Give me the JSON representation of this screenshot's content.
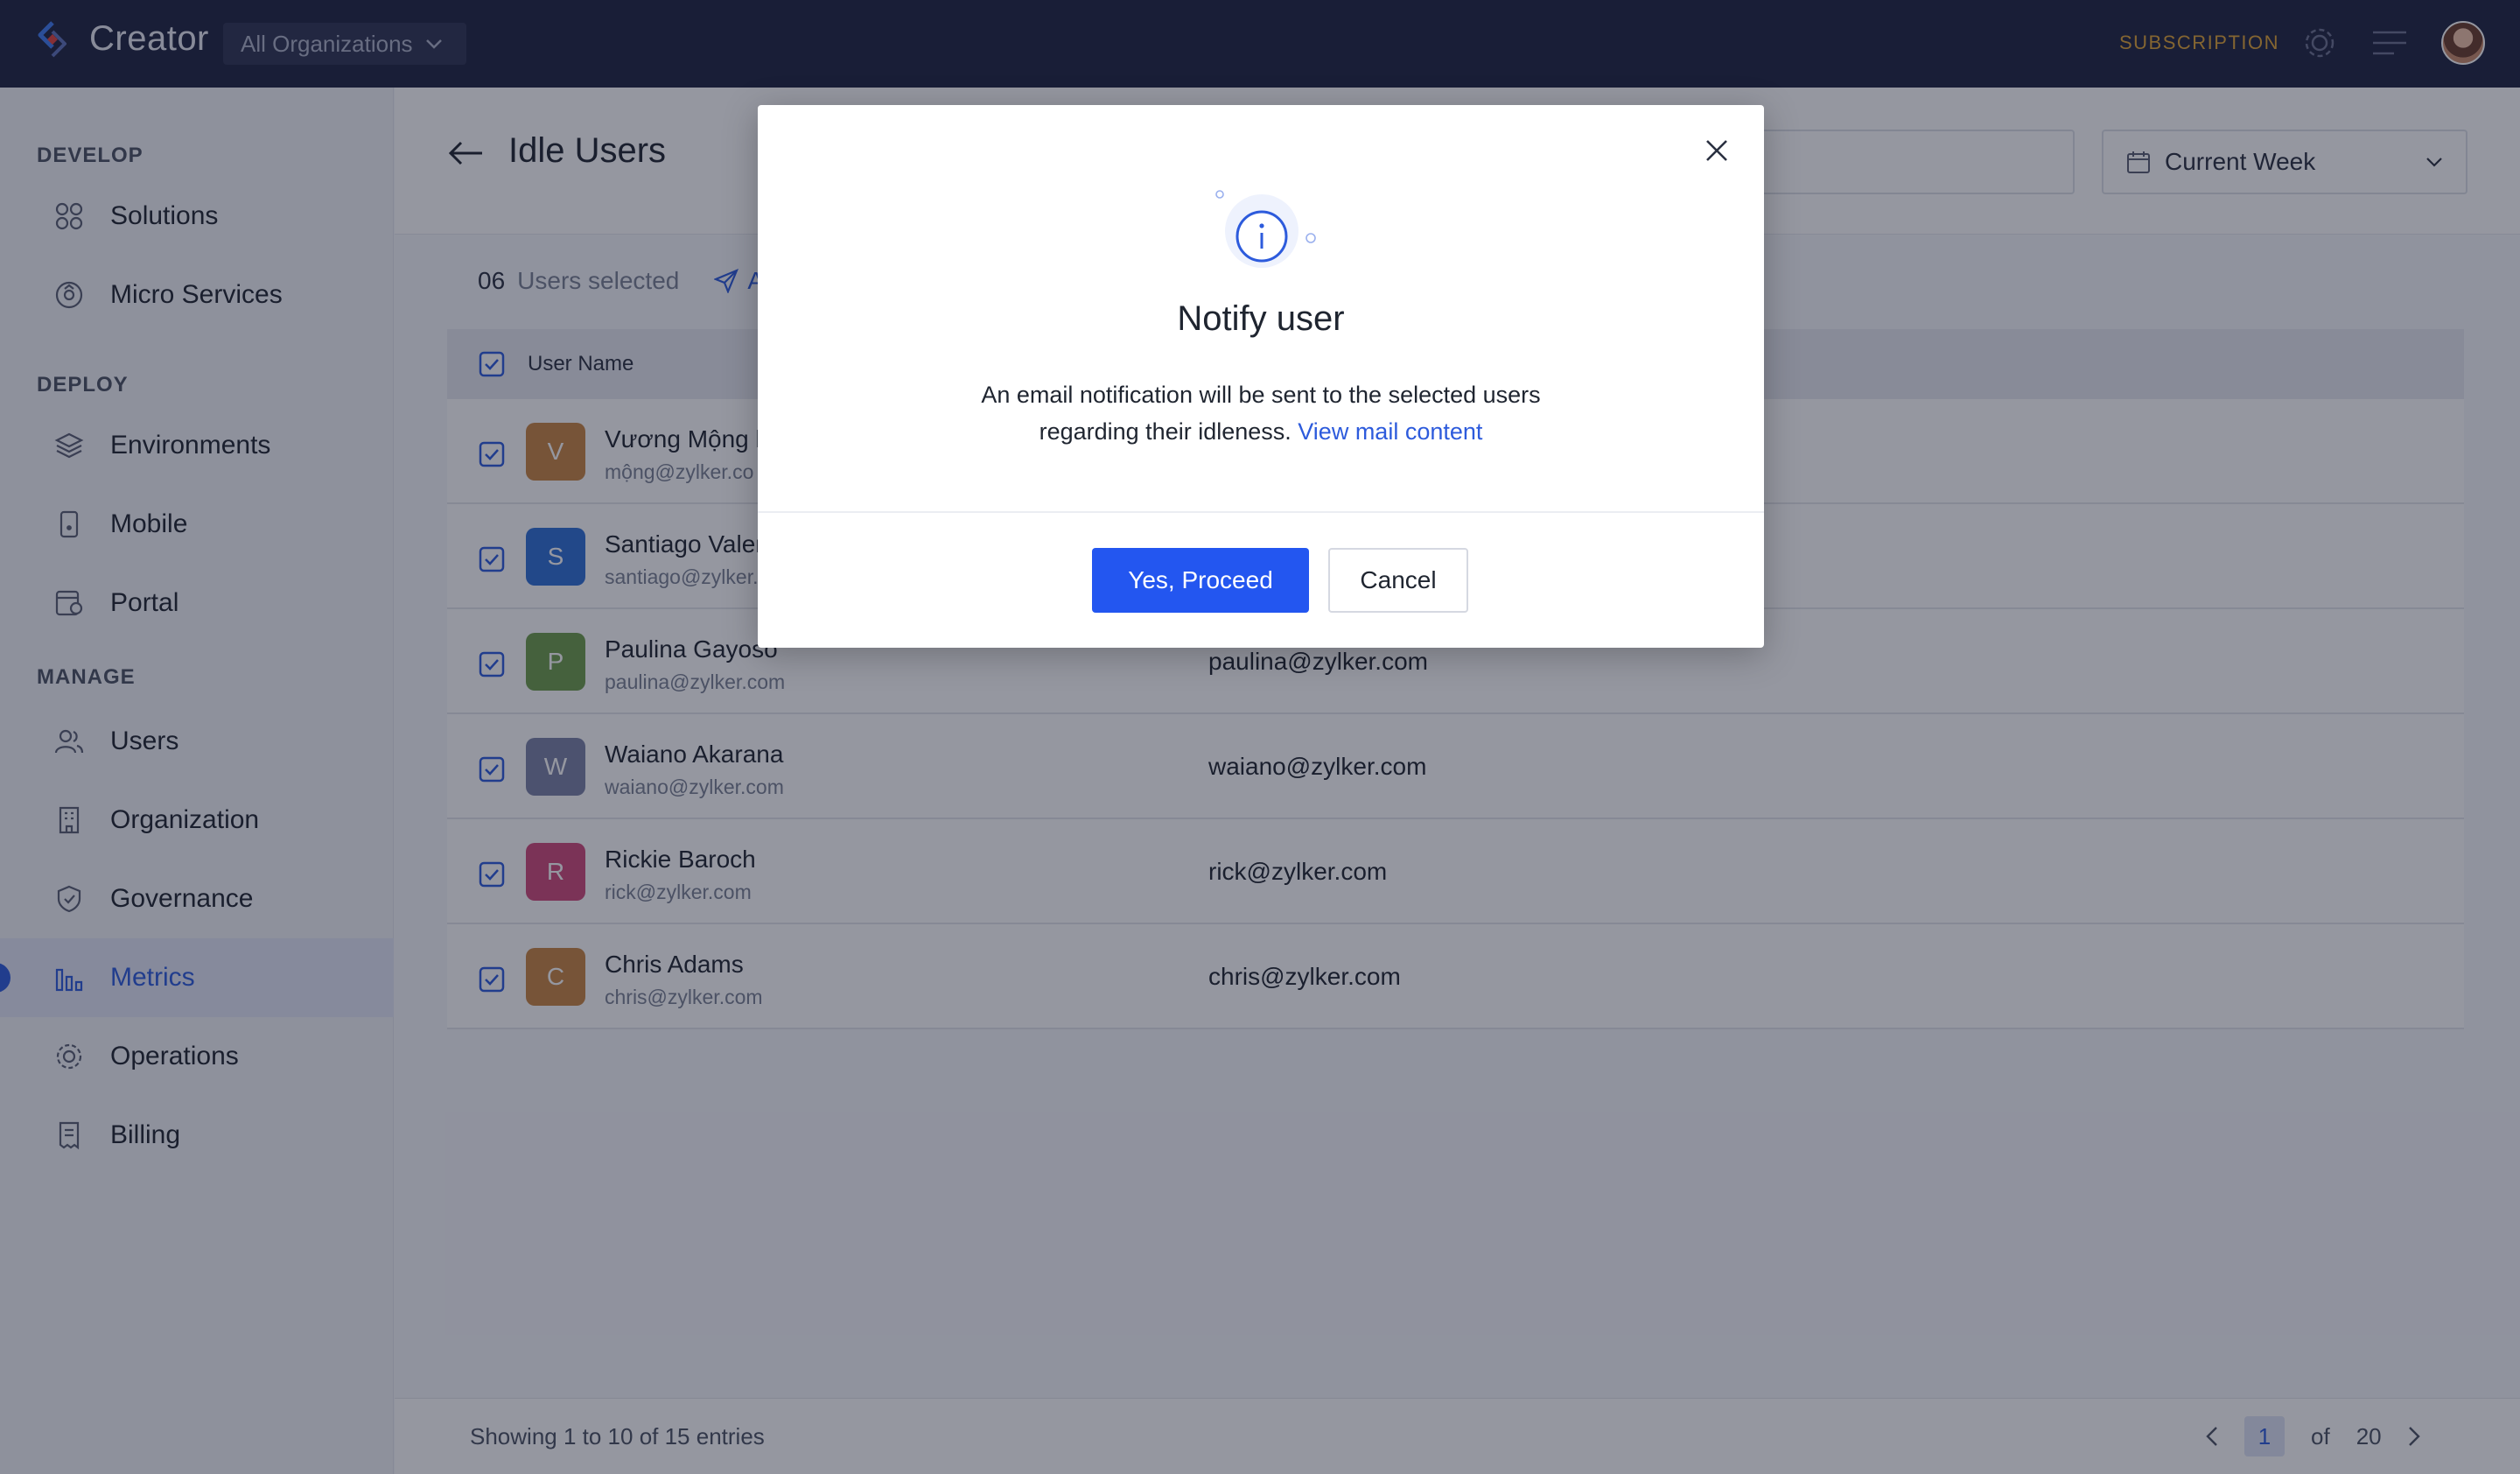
{
  "topbar": {
    "app_name": "Creator",
    "org_switch_label": "All Organizations",
    "subscription_label": "SUBSCRIPTION"
  },
  "sidebar": {
    "sections": [
      {
        "title": "DEVELOP"
      },
      {
        "title": "DEPLOY"
      },
      {
        "title": "MANAGE"
      }
    ],
    "items": [
      {
        "label": "Solutions",
        "icon": "grid-icon"
      },
      {
        "label": "Micro Services",
        "icon": "microservice-icon"
      },
      {
        "label": "Environments",
        "icon": "layers-icon"
      },
      {
        "label": "Mobile",
        "icon": "mobile-icon"
      },
      {
        "label": "Portal",
        "icon": "portal-icon"
      },
      {
        "label": "Users",
        "icon": "users-icon"
      },
      {
        "label": "Organization",
        "icon": "building-icon"
      },
      {
        "label": "Governance",
        "icon": "shield-icon"
      },
      {
        "label": "Metrics",
        "icon": "bar-chart-icon",
        "active": true
      },
      {
        "label": "Operations",
        "icon": "gear-icon"
      },
      {
        "label": "Billing",
        "icon": "receipt-icon"
      }
    ]
  },
  "header": {
    "title": "Idle Users",
    "date_filter": "Current Week"
  },
  "selection": {
    "count": "06",
    "label": "Users selected",
    "action_partial": "Al"
  },
  "table": {
    "col_username": "User Name",
    "rows": [
      {
        "initial": "V",
        "name": "Vương Mộng l",
        "email_sub": "mộng@zylker.co",
        "email": "",
        "color": "#c98542"
      },
      {
        "initial": "S",
        "name": "Santiago Valer",
        "email_sub": "santiago@zylker.",
        "email": "",
        "color": "#2f6fd6"
      },
      {
        "initial": "P",
        "name": "Paulina Gayoso",
        "email_sub": "paulina@zylker.com",
        "email": "paulina@zylker.com",
        "color": "#6e9d4c"
      },
      {
        "initial": "W",
        "name": "Waiano Akarana",
        "email_sub": "waiano@zylker.com",
        "email": "waiano@zylker.com",
        "color": "#7b82a6"
      },
      {
        "initial": "R",
        "name": "Rickie Baroch",
        "email_sub": "rick@zylker.com",
        "email": "rick@zylker.com",
        "color": "#d04a7a"
      },
      {
        "initial": "C",
        "name": "Chris Adams",
        "email_sub": "chris@zylker.com",
        "email": "chris@zylker.com",
        "color": "#c98542"
      }
    ]
  },
  "footer": {
    "info": "Showing 1 to 10 of 15 entries",
    "current_page": "1",
    "of_label": "of",
    "total_pages": "20"
  },
  "dialog": {
    "title": "Notify user",
    "message_line1": "An email notification will be sent to the selected users",
    "message_line2": "regarding their idleness.",
    "link": "View mail content",
    "confirm_label": "Yes, Proceed",
    "cancel_label": "Cancel"
  }
}
